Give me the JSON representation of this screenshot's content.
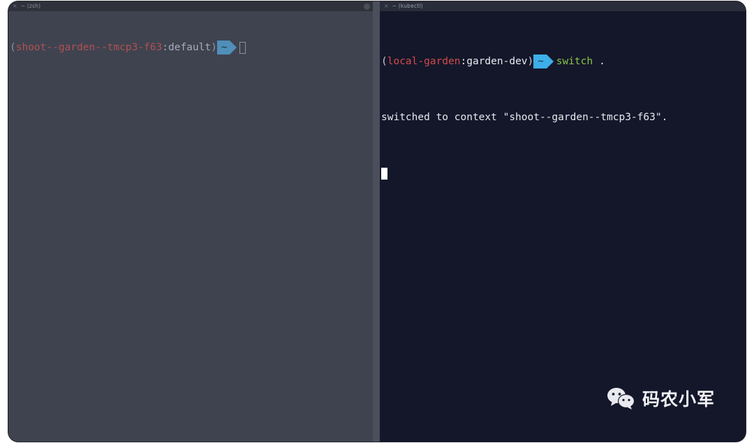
{
  "window": {
    "background_color": "#ffffff",
    "frame_color": "#2b2d36",
    "divider_color": "#4b4f5c"
  },
  "panes": {
    "left": {
      "titlebar": {
        "close_glyph": "×",
        "label": "~ (zsh)",
        "minimize_glyph": "",
        "close_button_glyph": "×"
      },
      "background_color": "#3f4350",
      "active": false,
      "prompt": {
        "open_paren": "(",
        "context": "shoot--garden--tmcp3-f63",
        "colon": ":",
        "namespace": "default",
        "close_paren": ")",
        "segment_glyph": "~",
        "segment_color": "#4f8fb8"
      },
      "command": "",
      "cursor_style": "hollow"
    },
    "right": {
      "titlebar": {
        "close_glyph": "×",
        "label": "~ (kubectl)"
      },
      "background_color": "#14172a",
      "active": true,
      "prompt": {
        "open_paren": "(",
        "context": "local-garden",
        "colon": ":",
        "namespace": "garden-dev",
        "close_paren": ")",
        "segment_glyph": "~",
        "segment_color": "#3daee9"
      },
      "command": "switch",
      "command_arg": ".",
      "output_lines": [
        "switched to context \"shoot--garden--tmcp3-f63\"."
      ],
      "cursor_style": "block"
    }
  },
  "watermark": {
    "icon": "wechat-icon",
    "text": "码农小军",
    "color": "#f2f3f6"
  }
}
